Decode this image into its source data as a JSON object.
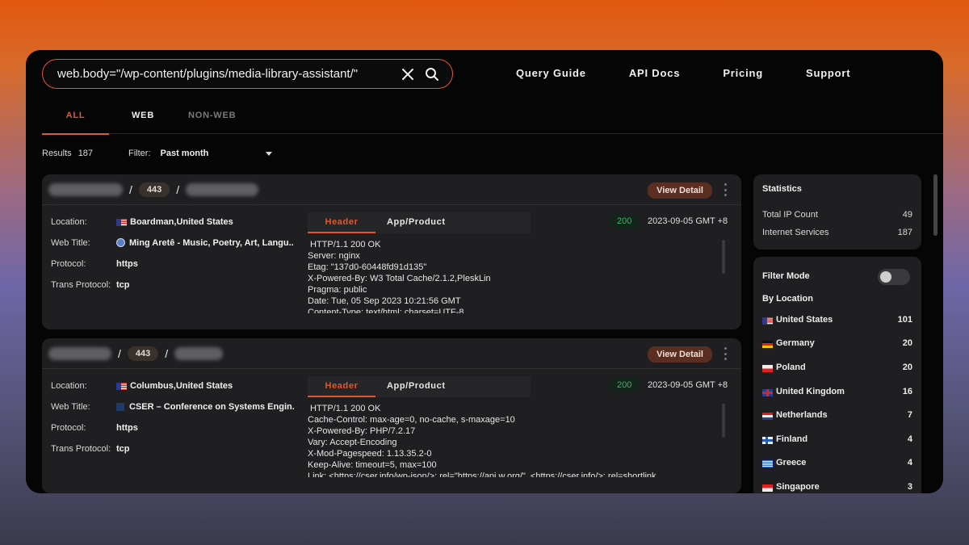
{
  "search": {
    "query": "web.body=\"/wp-content/plugins/media-library-assistant/\""
  },
  "nav": [
    "Query Guide",
    "API Docs",
    "Pricing",
    "Support"
  ],
  "tabs": {
    "all": "ALL",
    "web": "WEB",
    "non_web": "NON-WEB"
  },
  "results": {
    "label": "Results",
    "count": "187"
  },
  "filter": {
    "label": "Filter:",
    "value": "Past month"
  },
  "labels": {
    "location": "Location:",
    "web_title": "Web Title:",
    "protocol": "Protocol:",
    "trans_protocol": "Trans Protocol:",
    "view_detail": "View Detail",
    "header_tab": "Header",
    "app_tab": "App/Product"
  },
  "cards": [
    {
      "port": "443",
      "location": "Boardman,United States",
      "web_title": "Ming Aretê - Music, Poetry, Art, Langu...",
      "protocol": "https",
      "trans_protocol": "tcp",
      "status": "200",
      "date": "2023-09-05 GMT +8",
      "http": [
        "HTTP/1.1 200 OK",
        "Server: nginx",
        "Etag: \"137d0-60448fd91d135\"",
        "X-Powered-By: W3 Total Cache/2.1.2,PleskLin",
        "Pragma: public",
        "Date: Tue, 05 Sep 2023 10:21:56 GMT",
        "Content-Type: text/html; charset=UTF-8"
      ]
    },
    {
      "port": "443",
      "location": "Columbus,United States",
      "web_title": "CSER – Conference on Systems Engin...",
      "protocol": "https",
      "trans_protocol": "tcp",
      "status": "200",
      "date": "2023-09-05 GMT +8",
      "http": [
        "HTTP/1.1 200 OK",
        "Cache-Control: max-age=0, no-cache, s-maxage=10",
        "X-Powered-By: PHP/7.2.17",
        "Vary: Accept-Encoding",
        "X-Mod-Pagespeed: 1.13.35.2-0",
        "Keep-Alive: timeout=5, max=100",
        "Link: <https://cser.info/wp-json/>; rel=\"https://api.w.org/\", <https://cser.info/>; rel=shortlink"
      ]
    }
  ],
  "statistics": {
    "title": "Statistics",
    "rows": [
      {
        "label": "Total IP Count",
        "value": "49"
      },
      {
        "label": "Internet Services",
        "value": "187"
      }
    ]
  },
  "filter_mode": {
    "title": "Filter Mode",
    "by_location": "By Location"
  },
  "locations": [
    {
      "name": "United States",
      "count": "101",
      "flag": "us"
    },
    {
      "name": "Germany",
      "count": "20",
      "flag": "de"
    },
    {
      "name": "Poland",
      "count": "20",
      "flag": "pl"
    },
    {
      "name": "United Kingdom",
      "count": "16",
      "flag": "gb"
    },
    {
      "name": "Netherlands",
      "count": "7",
      "flag": "nl"
    },
    {
      "name": "Finland",
      "count": "4",
      "flag": "fi"
    },
    {
      "name": "Greece",
      "count": "4",
      "flag": "gr"
    },
    {
      "name": "Singapore",
      "count": "3",
      "flag": "sg"
    }
  ]
}
